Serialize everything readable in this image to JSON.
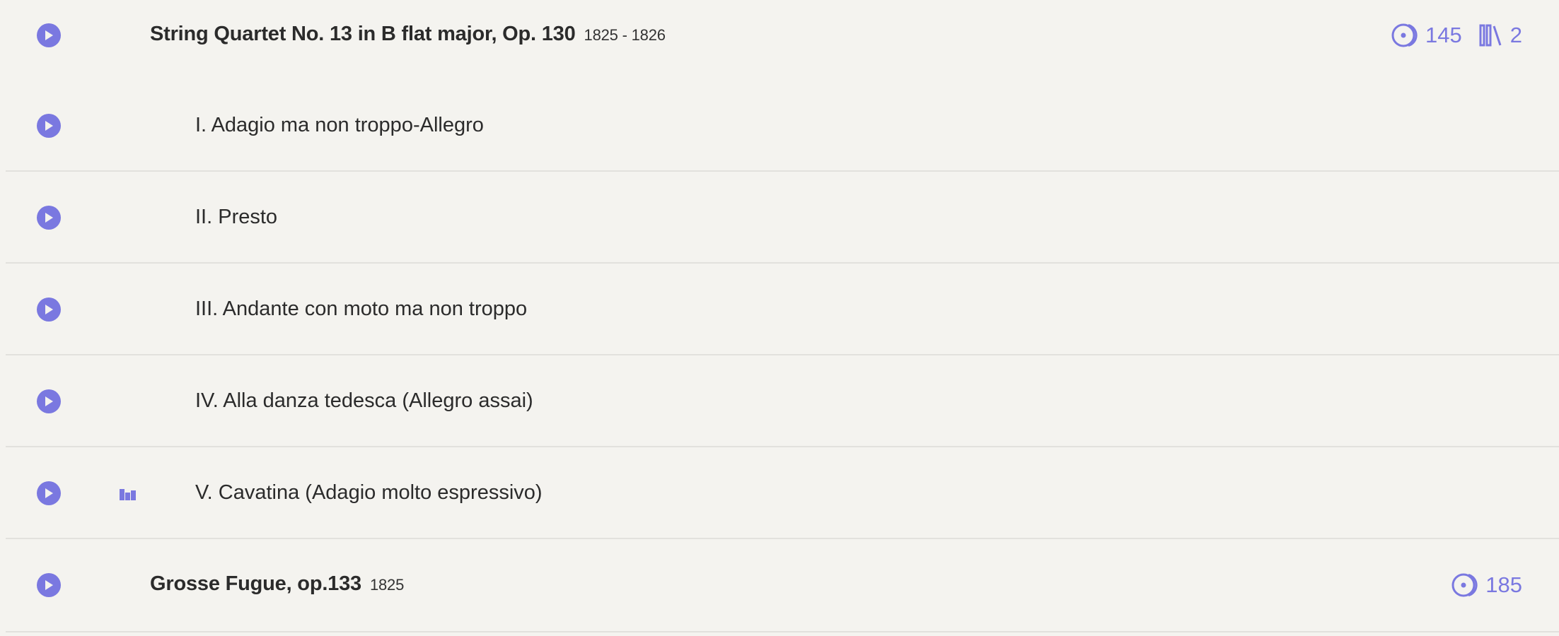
{
  "colors": {
    "accent": "#7a78e0",
    "background": "#f4f3ef",
    "divider": "#e2e1dd",
    "text": "#2b2b2b"
  },
  "works": [
    {
      "title": "String Quartet No. 13 in B flat major, Op. 130",
      "years": "1825 - 1826",
      "recordings_icon": "disc-icon",
      "recordings_count": "145",
      "scores_icon": "library-icon",
      "scores_count": "2",
      "movements": [
        {
          "label": "I. Adagio ma non troppo-Allegro"
        },
        {
          "label": "II. Presto"
        },
        {
          "label": "III. Andante con moto ma non troppo"
        },
        {
          "label": "IV. Alla danza tedesca (Allegro assai)"
        },
        {
          "label": "V. Cavatina (Adagio molto espressivo)",
          "indicator_icon": "playing-bars-icon"
        }
      ]
    },
    {
      "title": "Grosse Fugue, op.133",
      "years": "1825",
      "recordings_icon": "disc-icon",
      "recordings_count": "185"
    }
  ]
}
